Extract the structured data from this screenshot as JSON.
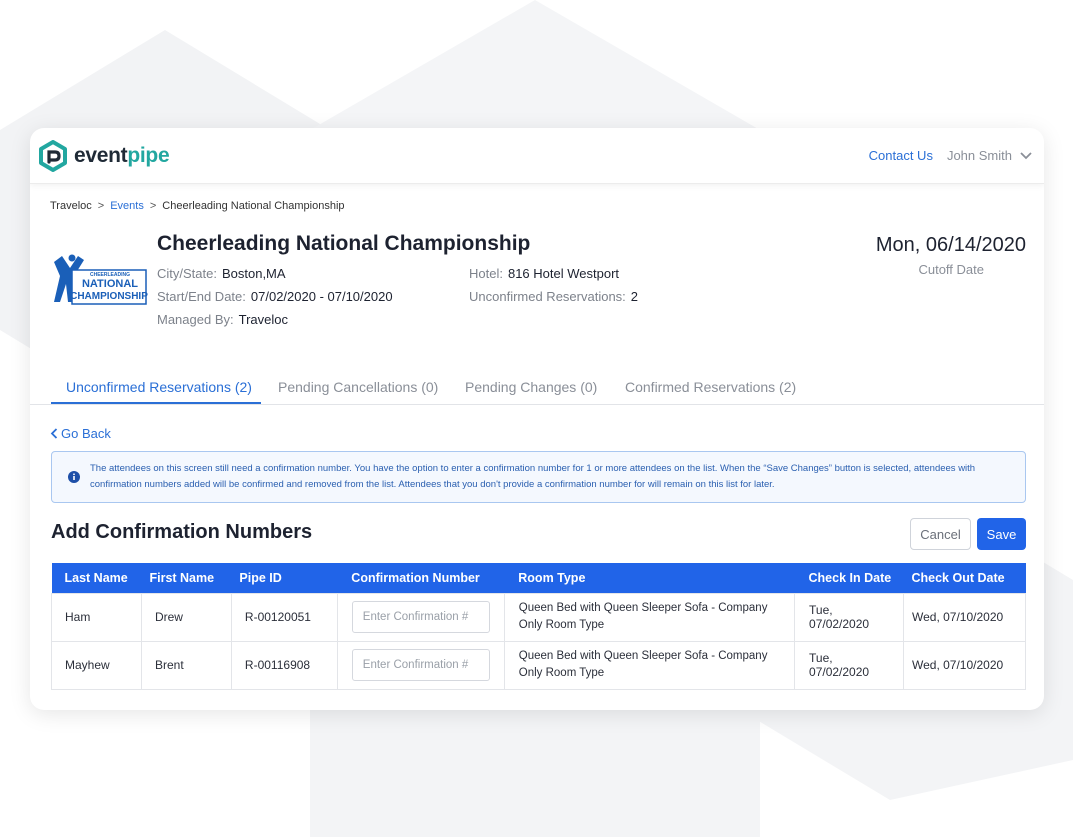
{
  "brand": {
    "name_part1": "event",
    "name_part2": "pipe",
    "accent_color": "#22a7a0",
    "primary_color": "#2164e8"
  },
  "header": {
    "contact_label": "Contact Us",
    "user_name": "John Smith",
    "user_menu_icon": "chevron-down-icon"
  },
  "breadcrumb": {
    "items": [
      "Traveloc",
      "Events",
      "Cheerleading National Championship"
    ]
  },
  "event": {
    "title": "Cheerleading National Championship",
    "logo_line1": "CHEERLEADING",
    "logo_line2": "NATIONAL",
    "logo_line3": "CHAMPIONSHIP",
    "city_state_label": "City/State:",
    "city_state": "Boston,MA",
    "dates_label": "Start/End Date:",
    "dates": "07/02/2020 - 07/10/2020",
    "managed_by_label": "Managed By:",
    "managed_by": "Traveloc",
    "hotel_label": "Hotel:",
    "hotel": "816 Hotel Westport",
    "unconfirmed_label": "Unconfirmed Reservations:",
    "unconfirmed_count": "2",
    "cutoff_date": "Mon, 06/14/2020",
    "cutoff_label": "Cutoff Date"
  },
  "tabs": [
    {
      "label": "Unconfirmed Reservations (2)",
      "active": true
    },
    {
      "label": "Pending Cancellations (0)",
      "active": false
    },
    {
      "label": "Pending Changes (0)",
      "active": false
    },
    {
      "label": "Confirmed Reservations (2)",
      "active": false
    }
  ],
  "go_back_label": "Go Back",
  "info_message": "The attendees on this screen still need a confirmation number. You have the option to enter a confirmation number for 1 or more attendees on the list. When the “Save Changes” button is selected, attendees with confirmation numbers added will be confirmed and removed from the list. Attendees that you don't provide a confirmation number for will remain on this list for later.",
  "section": {
    "title": "Add Confirmation Numbers",
    "cancel_label": "Cancel",
    "save_label": "Save"
  },
  "table": {
    "headers": [
      "Last Name",
      "First Name",
      "Pipe ID",
      "Confirmation Number",
      "Room Type",
      "Check In Date",
      "Check Out Date"
    ],
    "input_placeholder": "Enter Confirmation #",
    "rows": [
      {
        "last_name": "Ham",
        "first_name": "Drew",
        "pipe_id": "R-00120051",
        "confirmation": "",
        "room_type": "Queen Bed with Queen Sleeper Sofa - Company Only Room Type",
        "check_in": "Tue, 07/02/2020",
        "check_out": "Wed, 07/10/2020"
      },
      {
        "last_name": "Mayhew",
        "first_name": "Brent",
        "pipe_id": "R-00116908",
        "confirmation": "",
        "room_type": "Queen Bed with Queen Sleeper Sofa - Company Only Room Type",
        "check_in": "Tue, 07/02/2020",
        "check_out": "Wed, 07/10/2020"
      }
    ]
  }
}
